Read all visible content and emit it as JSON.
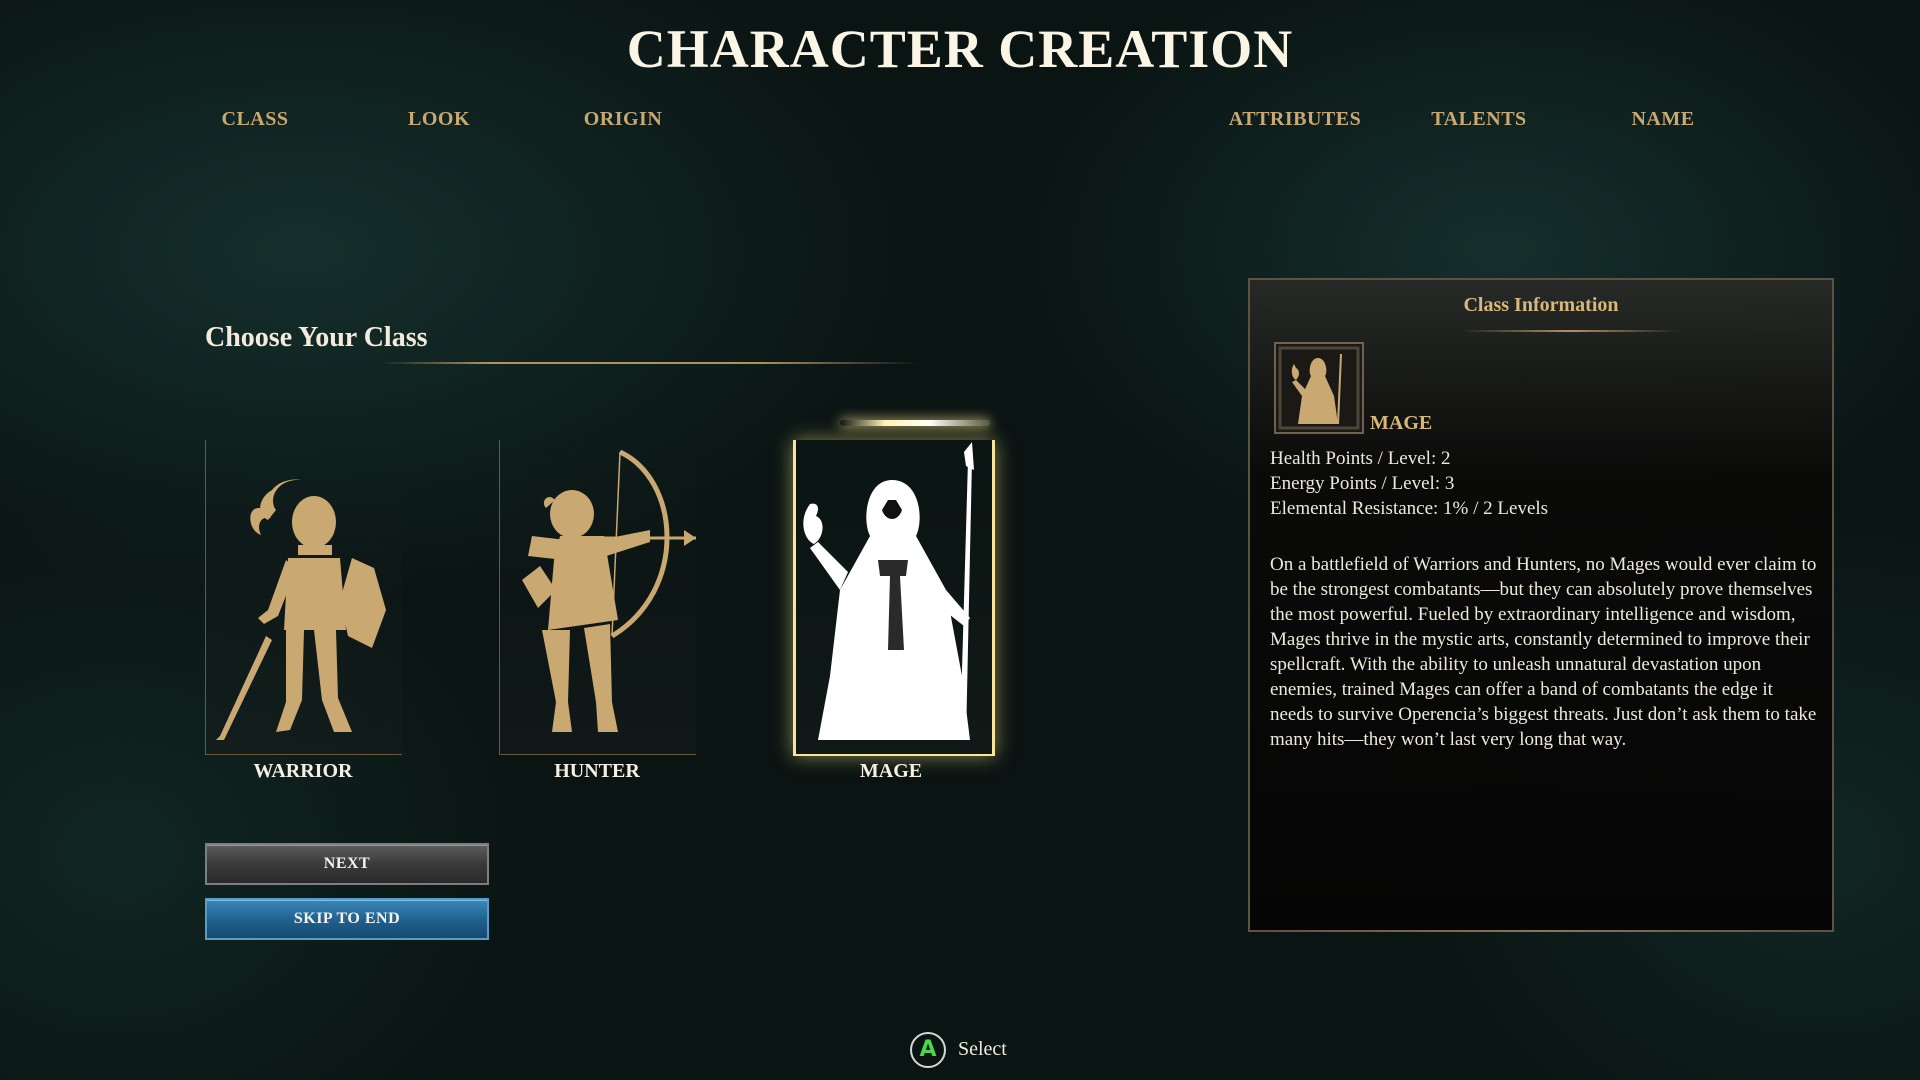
{
  "header": {
    "title": "CHARACTER CREATION"
  },
  "steps": [
    "CLASS",
    "LOOK",
    "ORIGIN",
    "ATTRIBUTES",
    "TALENTS",
    "NAME"
  ],
  "section": {
    "title": "Choose Your Class"
  },
  "classes": [
    {
      "label": "WARRIOR",
      "icon": "warrior-icon"
    },
    {
      "label": "HUNTER",
      "icon": "hunter-icon"
    },
    {
      "label": "MAGE",
      "icon": "mage-icon",
      "selected": true
    }
  ],
  "buttons": {
    "next": "NEXT",
    "skip": "SKIP TO END"
  },
  "info": {
    "title": "Class Information",
    "class_name": "MAGE",
    "stats": [
      "Health Points / Level: 2",
      "Energy Points / Level: 3",
      "Elemental Resistance: 1% / 2 Levels"
    ],
    "description": "On a battlefield of Warriors and Hunters, no Mages would ever claim to be the strongest combatants—but they can absolutely prove themselves the most powerful. Fueled by extraordinary intelligence and wisdom, Mages thrive in the mystic arts, constantly determined to improve their spellcraft. With the ability to unleash unnatural devastation upon enemies, trained Mages can offer a band of combatants the edge it needs to survive Operencia’s biggest threats. Just don’t ask them to take many hits—they won’t last very long that way."
  },
  "prompt": {
    "button": "A",
    "label": "Select"
  },
  "colors": {
    "gold": "#c9a871",
    "selected_glow": "#f6e59a",
    "skip_button": "#1f5f8d",
    "next_button": "#3a3a3a"
  }
}
